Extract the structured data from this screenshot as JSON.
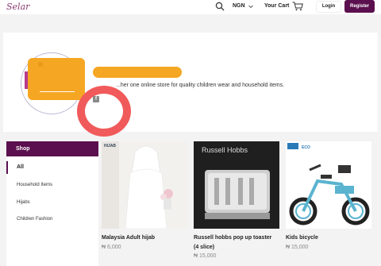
{
  "header": {
    "logo": "Selar",
    "currency": "NGN",
    "cart_label": "Your Cart",
    "login_label": "Login",
    "register_label": "Register"
  },
  "store": {
    "description": "...her one online store for quality children wear and household items."
  },
  "sidebar": {
    "title": "Shop",
    "items": [
      {
        "label": "All",
        "active": true
      },
      {
        "label": "Household Items"
      },
      {
        "label": "Hijabs"
      },
      {
        "label": "Children Fashion"
      }
    ]
  },
  "products": [
    {
      "title": "Malaysia Adult hijab",
      "price": "₦ 6,000",
      "image_text": "HIJAB"
    },
    {
      "title_line1": "Russell hobbs pop up toaster",
      "title_line2": "(4 slice)",
      "price": "₦ 15,000",
      "image_text": "Russell Hobbs"
    },
    {
      "title": "Kids bicycle",
      "price": "₦ 15,000",
      "image_text": "ECO"
    }
  ],
  "colors": {
    "brand": "#5b0f4e",
    "redaction": "#f5a623",
    "annotation": "#f15a5a"
  }
}
